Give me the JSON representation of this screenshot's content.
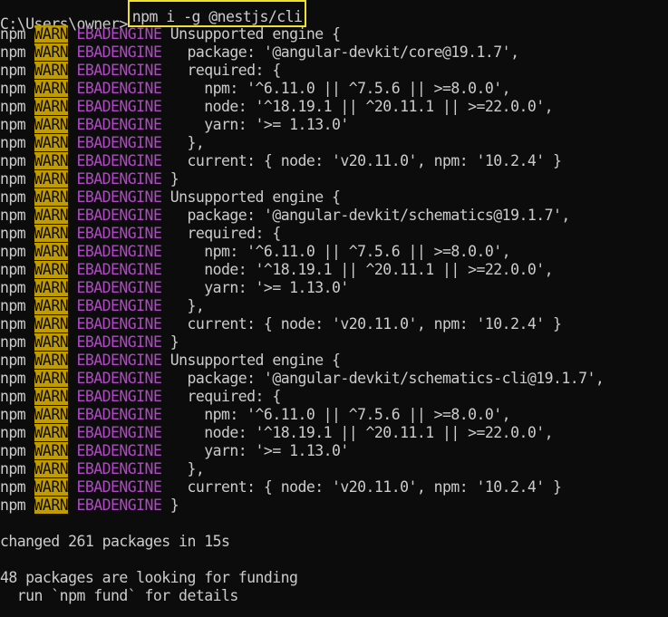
{
  "prompt": {
    "path": "C:\\Users\\owner>",
    "command": "npm i -g @nestjs/cli"
  },
  "warn_lines": [
    {
      "prefix": "npm",
      "level": "WARN",
      "code": "EBADENGINE",
      "text": " Unsupported engine {"
    },
    {
      "prefix": "npm",
      "level": "WARN",
      "code": "EBADENGINE",
      "text": "   package: '@angular-devkit/core@19.1.7',"
    },
    {
      "prefix": "npm",
      "level": "WARN",
      "code": "EBADENGINE",
      "text": "   required: {"
    },
    {
      "prefix": "npm",
      "level": "WARN",
      "code": "EBADENGINE",
      "text": "     npm: '^6.11.0 || ^7.5.6 || >=8.0.0',"
    },
    {
      "prefix": "npm",
      "level": "WARN",
      "code": "EBADENGINE",
      "text": "     node: '^18.19.1 || ^20.11.1 || >=22.0.0',"
    },
    {
      "prefix": "npm",
      "level": "WARN",
      "code": "EBADENGINE",
      "text": "     yarn: '>= 1.13.0'"
    },
    {
      "prefix": "npm",
      "level": "WARN",
      "code": "EBADENGINE",
      "text": "   },"
    },
    {
      "prefix": "npm",
      "level": "WARN",
      "code": "EBADENGINE",
      "text": "   current: { node: 'v20.11.0', npm: '10.2.4' }"
    },
    {
      "prefix": "npm",
      "level": "WARN",
      "code": "EBADENGINE",
      "text": " }"
    },
    {
      "prefix": "npm",
      "level": "WARN",
      "code": "EBADENGINE",
      "text": " Unsupported engine {"
    },
    {
      "prefix": "npm",
      "level": "WARN",
      "code": "EBADENGINE",
      "text": "   package: '@angular-devkit/schematics@19.1.7',"
    },
    {
      "prefix": "npm",
      "level": "WARN",
      "code": "EBADENGINE",
      "text": "   required: {"
    },
    {
      "prefix": "npm",
      "level": "WARN",
      "code": "EBADENGINE",
      "text": "     npm: '^6.11.0 || ^7.5.6 || >=8.0.0',"
    },
    {
      "prefix": "npm",
      "level": "WARN",
      "code": "EBADENGINE",
      "text": "     node: '^18.19.1 || ^20.11.1 || >=22.0.0',"
    },
    {
      "prefix": "npm",
      "level": "WARN",
      "code": "EBADENGINE",
      "text": "     yarn: '>= 1.13.0'"
    },
    {
      "prefix": "npm",
      "level": "WARN",
      "code": "EBADENGINE",
      "text": "   },"
    },
    {
      "prefix": "npm",
      "level": "WARN",
      "code": "EBADENGINE",
      "text": "   current: { node: 'v20.11.0', npm: '10.2.4' }"
    },
    {
      "prefix": "npm",
      "level": "WARN",
      "code": "EBADENGINE",
      "text": " }"
    },
    {
      "prefix": "npm",
      "level": "WARN",
      "code": "EBADENGINE",
      "text": " Unsupported engine {"
    },
    {
      "prefix": "npm",
      "level": "WARN",
      "code": "EBADENGINE",
      "text": "   package: '@angular-devkit/schematics-cli@19.1.7',"
    },
    {
      "prefix": "npm",
      "level": "WARN",
      "code": "EBADENGINE",
      "text": "   required: {"
    },
    {
      "prefix": "npm",
      "level": "WARN",
      "code": "EBADENGINE",
      "text": "     npm: '^6.11.0 || ^7.5.6 || >=8.0.0',"
    },
    {
      "prefix": "npm",
      "level": "WARN",
      "code": "EBADENGINE",
      "text": "     node: '^18.19.1 || ^20.11.1 || >=22.0.0',"
    },
    {
      "prefix": "npm",
      "level": "WARN",
      "code": "EBADENGINE",
      "text": "     yarn: '>= 1.13.0'"
    },
    {
      "prefix": "npm",
      "level": "WARN",
      "code": "EBADENGINE",
      "text": "   },"
    },
    {
      "prefix": "npm",
      "level": "WARN",
      "code": "EBADENGINE",
      "text": "   current: { node: 'v20.11.0', npm: '10.2.4' }"
    },
    {
      "prefix": "npm",
      "level": "WARN",
      "code": "EBADENGINE",
      "text": " }"
    }
  ],
  "summary": {
    "changed": "changed 261 packages in 15s",
    "funding": "48 packages are looking for funding",
    "fund_hint": "  run `npm fund` for details"
  },
  "colors": {
    "background": "#0c0c0c",
    "foreground": "#cccccc",
    "warn_bg": "#c19c00",
    "code": "#b148c6",
    "highlight_box": "#f0e22a"
  }
}
